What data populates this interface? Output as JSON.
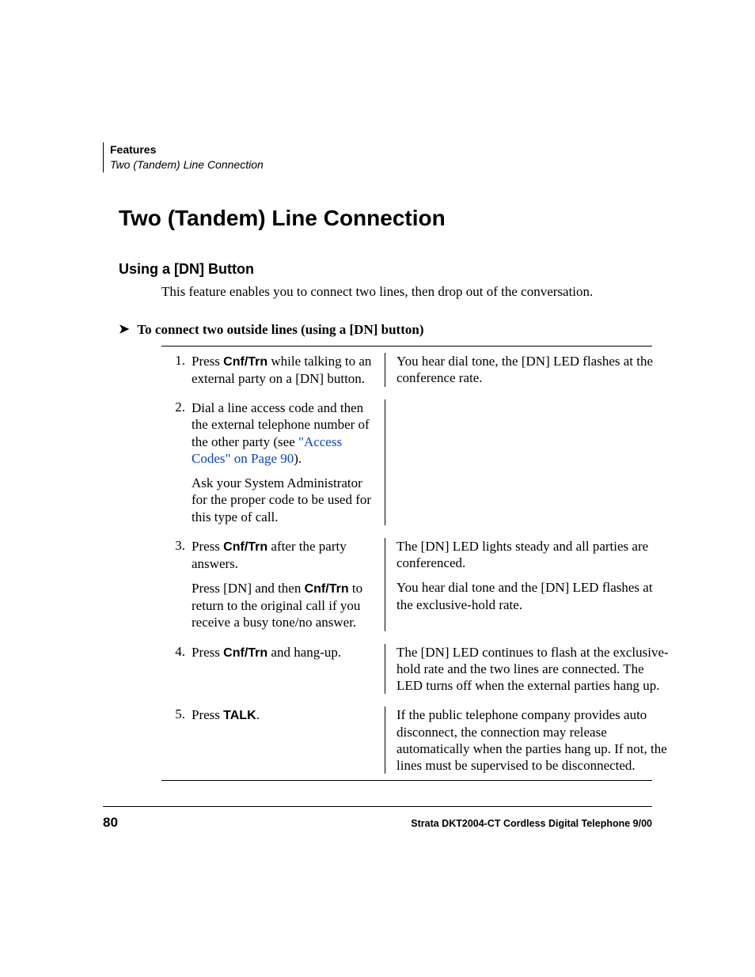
{
  "running_head": {
    "title": "Features",
    "subtitle": "Two (Tandem) Line Connection"
  },
  "h1": "Two (Tandem) Line Connection",
  "h2": "Using a [DN] Button",
  "intro": "This feature enables you to connect two lines, then drop out of the conversation.",
  "procedure_title": "To connect two outside lines (using a [DN] button)",
  "link_text": "\"Access Codes\" on Page 90",
  "steps": [
    {
      "num": "1.",
      "action_pre": "Press ",
      "action_key": "Cnf/Trn",
      "action_post": " while talking to an external party on a [DN] button.",
      "result": "You hear dial tone, the [DN] LED flashes at the conference rate."
    },
    {
      "num": "2.",
      "action_pre": "Dial a line access code and then the external telephone number of the other party (see ",
      "action_post": ").",
      "action_extra": "Ask your System Administrator for the proper code to be used for this type of call.",
      "result": ""
    },
    {
      "num": "3.",
      "action_pre": "Press ",
      "action_key": "Cnf/Trn",
      "action_post": " after the party answers.",
      "sub_action_pre": "Press [DN] and then ",
      "sub_action_key": "Cnf/Trn",
      "sub_action_post": " to return to the original call if you receive a busy tone/no answer.",
      "result": "The [DN] LED lights steady and all parties are conferenced.",
      "sub_result": "You hear dial tone and the [DN] LED flashes at the exclusive-hold rate."
    },
    {
      "num": "4.",
      "action_pre": "Press ",
      "action_key": "Cnf/Trn",
      "action_post": " and hang-up.",
      "result": "The [DN] LED continues to flash at the exclusive-hold rate and the two lines are connected. The LED turns off when the external parties hang up."
    },
    {
      "num": "5.",
      "action_pre": "Press ",
      "action_key": "TALK",
      "action_post": ".",
      "result": "If the public telephone company provides auto disconnect, the connection may release automatically when the parties hang up. If not, the lines must be supervised to be disconnected."
    }
  ],
  "footer": {
    "page": "80",
    "text": "Strata DKT2004-CT Cordless Digital Telephone   9/00"
  }
}
